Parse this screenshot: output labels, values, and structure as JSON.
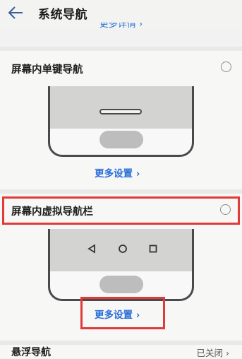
{
  "header": {
    "title": "系统导航",
    "back_icon": "arrow-left-icon"
  },
  "top_link": {
    "label": "更多详情 ›"
  },
  "options": [
    {
      "label": "屏幕内单键导航",
      "selected": false,
      "more_label": "更多设置 ›"
    },
    {
      "label": "屏幕内虚拟导航栏",
      "selected": false,
      "more_label": "更多设置 ›",
      "nav_icons": [
        "back-triangle-icon",
        "home-circle-icon",
        "recents-square-icon"
      ]
    }
  ],
  "bottom": {
    "label": "悬浮导航",
    "status": "已关闭 ›"
  },
  "colors": {
    "accent": "#2a6ed8",
    "highlight": "#e03a3a",
    "background": "#f1f2f1"
  }
}
